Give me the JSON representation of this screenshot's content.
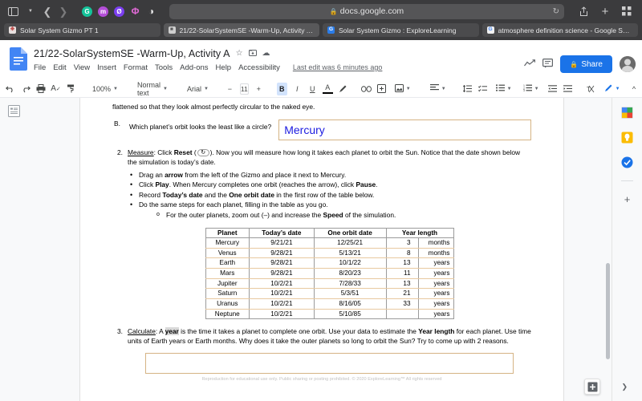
{
  "browser": {
    "url": "docs.google.com",
    "lock_icon": "lock-icon",
    "reload_icon": "reload-icon",
    "back_icon": "chevron-left-icon",
    "forward_icon": "chevron-right-icon",
    "sidebar_icon": "sidebar-toggle-icon",
    "share_icon": "share-up-icon",
    "new_tab_icon": "plus-icon",
    "tab_overview_icon": "grid-icon",
    "extensions": [
      {
        "name": "grammarly-extension-icon",
        "color": "#15c39a",
        "letter": "G"
      },
      {
        "name": "honey-extension-icon",
        "color": "#b44ed8",
        "letter": "m"
      },
      {
        "name": "adblock-extension-icon",
        "color": "#8a3ffc",
        "letter": "Ø"
      },
      {
        "name": "kami-extension-icon",
        "color": "#e06ad6",
        "letter": "ĸ"
      },
      {
        "name": "darkreader-extension-icon",
        "color": "#d8d8d8",
        "letter": "◑"
      }
    ],
    "tabs": [
      {
        "title": "Solar System Gizmo PT 1",
        "favicon": "solar-system-favicon",
        "favicon_color": "#e8e0df",
        "favicon_letter": "❉",
        "active": false
      },
      {
        "title": "21/22-SolarSystemSE -Warm-Up, Activity A - Googl...",
        "favicon": "google-docs-favicon",
        "favicon_color": "#bdbdbd",
        "favicon_letter": "■",
        "active": true
      },
      {
        "title": "Solar System Gizmo : ExploreLearning",
        "favicon": "gizmo-favicon",
        "favicon_color": "#1a73e8",
        "favicon_letter": "G",
        "active": false
      },
      {
        "title": "atmosphere definition science - Google Search",
        "favicon": "google-search-favicon",
        "favicon_color": "#f1f1f1",
        "favicon_letter": "G",
        "active": false
      }
    ]
  },
  "docs": {
    "logo_name": "google-docs-logo",
    "title": "21/22-SolarSystemSE -Warm-Up, Activity A",
    "title_icons": [
      "star-icon",
      "move-to-folder-icon",
      "cloud-saved-icon"
    ],
    "menus": [
      "File",
      "Edit",
      "View",
      "Insert",
      "Format",
      "Tools",
      "Add-ons",
      "Help",
      "Accessibility"
    ],
    "last_edit": "Last edit was 6 minutes ago",
    "activity_icon": "activity-chart-icon",
    "comments_icon": "comment-icon",
    "share_label": "Share",
    "share_lock_icon": "lock-icon",
    "avatar_name": "user-avatar",
    "toolbar": {
      "undo_icon": "undo-icon",
      "redo_icon": "redo-icon",
      "print_icon": "print-icon",
      "spellcheck_icon": "spellcheck-icon",
      "paint_format_icon": "paint-format-icon",
      "zoom": "100%",
      "paragraph_style": "Normal text",
      "font": "Arial",
      "font_size": "11",
      "decrease_font": "−",
      "increase_font": "+",
      "bold": "B",
      "italic": "I",
      "underline": "U",
      "text_color": "A",
      "highlight_icon": "highlight-pen-icon",
      "link_icon": "link-icon",
      "comment_add_icon": "add-comment-icon",
      "image_icon": "insert-image-icon",
      "align_icon": "align-left-icon",
      "line_spacing_icon": "line-spacing-icon",
      "checklist_icon": "checklist-icon",
      "bulleted_list_icon": "bulleted-list-icon",
      "numbered_list_icon": "numbered-list-icon",
      "decrease_indent_icon": "decrease-indent-icon",
      "increase_indent_icon": "increase-indent-icon",
      "clear_format_icon": "clear-formatting-icon",
      "editing_mode_icon": "editing-pencil-icon",
      "hide_menus_icon": "chevron-up-icon"
    }
  },
  "outline": {
    "button_name": "show-document-outline",
    "icon": "outline-icon"
  },
  "right_rail": {
    "items": [
      {
        "name": "google-calendar-icon"
      },
      {
        "name": "google-keep-icon"
      },
      {
        "name": "google-tasks-icon"
      }
    ],
    "add_icon": "plus-icon"
  },
  "fab": {
    "explore_icon": "explore-icon",
    "chevron_icon": "chevron-right-icon"
  },
  "document": {
    "clipped_line": "flattened so that they look almost perfectly circular to the naked eye.",
    "question_b": {
      "letter": "B.",
      "prompt": "Which planet’s orbit looks the least like a circle?",
      "answer": "Mercury"
    },
    "item2": {
      "number": "2.",
      "label": "Measure",
      "lead_a": ": Click ",
      "lead_bold": "Reset",
      "reset_icon": "reset-arrow-icon",
      "lead_b": "). Now you will measure how long it takes each planet to orbit the Sun. Notice that the date shown below the simulation is today’s date.",
      "bullets": [
        {
          "pre": "Drag an ",
          "b1": "arrow",
          "post": " from the left of the Gizmo and place it next to Mercury."
        },
        {
          "pre": "Click ",
          "b1": "Play",
          "post": ". When Mercury completes one orbit (reaches the arrow), click ",
          "b2": "Pause",
          "post2": "."
        },
        {
          "pre": "Record ",
          "b1": "Today’s date",
          "post": " and the ",
          "b2": "One orbit date",
          "post2": " in the first row of the table below."
        },
        {
          "pre": "Do the same steps for each planet, filling in the table as you go.",
          "b1": "",
          "post": ""
        }
      ],
      "sub_bullet": {
        "pre": "For the outer planets, zoom out (–) and increase the ",
        "b1": "Speed",
        "post": " of the simulation."
      }
    },
    "item3": {
      "number": "3.",
      "label": "Calculate",
      "t1": ": A ",
      "hl": "year",
      "t2": " is the time it takes a planet to complete one orbit. Use your data to estimate the ",
      "b1": "Year length",
      "t3": " for each planet. Use time units of Earth years or Earth months. Why does it take the outer planets so long to orbit the Sun? Try to come up with 2 reasons.",
      "answer": ""
    },
    "footer": "Reproduction for educational use only. Public sharing or posting prohibited. © 2020 ExploreLearning™ All rights reserved"
  },
  "table": {
    "headers": [
      "Planet",
      "Today’s date",
      "One orbit date",
      "Year length"
    ],
    "rows": [
      {
        "planet": "Mercury",
        "today": "9/21/21",
        "orbit": "12/25/21",
        "num": "3",
        "unit": "months"
      },
      {
        "planet": "Venus",
        "today": "9/28/21",
        "orbit": "5/13/21",
        "num": "8",
        "unit": "months"
      },
      {
        "planet": "Earth",
        "today": "9/28/21",
        "orbit": "10/1/22",
        "num": "13",
        "unit": "years"
      },
      {
        "planet": "Mars",
        "today": "9/28/21",
        "orbit": "8/20/23",
        "num": "11",
        "unit": "years"
      },
      {
        "planet": "Jupiter",
        "today": "10/2/21",
        "orbit": "7/28/33",
        "num": "13",
        "unit": "years"
      },
      {
        "planet": "Saturn",
        "today": "10/2/21",
        "orbit": "5/3/51",
        "num": "21",
        "unit": "years"
      },
      {
        "planet": "Uranus",
        "today": "10/2/21",
        "orbit": "8/16/05",
        "num": "33",
        "unit": "years"
      },
      {
        "planet": "Neptune",
        "today": "10/2/21",
        "orbit": "5/10/85",
        "num": "",
        "unit": "years"
      }
    ]
  },
  "colors": {
    "accent": "#1a73e8",
    "answer_text": "#1c1ce0",
    "box_border": "#d5b384",
    "chrome_bg": "#3b3b3d"
  }
}
